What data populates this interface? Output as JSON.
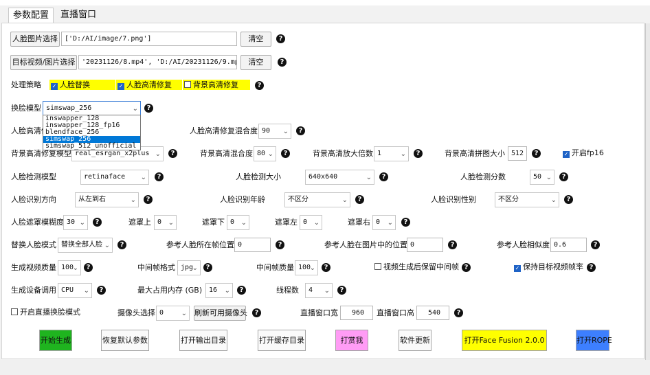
{
  "tabs": [
    "参数配置",
    "直播窗口"
  ],
  "face_image": {
    "label": "人脸图片选择",
    "value": "['D:/AI/image/7.png']",
    "clear": "清空"
  },
  "target_video": {
    "label": "目标视频/图片选择",
    "value": "'20231126/8.mp4', 'D:/AI/20231126/9.mp4']",
    "clear": "清空"
  },
  "strategy": {
    "label": "处理策略",
    "options": [
      {
        "label": "人脸替换",
        "checked": true
      },
      {
        "label": "人脸高清修复",
        "checked": true
      },
      {
        "label": "背景高清修复",
        "checked": false
      }
    ]
  },
  "swap_model": {
    "label": "换脸模型",
    "value": "simswap_256",
    "options": [
      "inswapper_128",
      "inswapper_128_fp16",
      "blendface_256",
      "simswap_256",
      "simswap_512_unofficial"
    ],
    "selected_index": 3
  },
  "face_enhance": {
    "label": "人脸高清修",
    "blend_label": "人脸高清修复混合度",
    "blend_value": "90"
  },
  "bg_enhance": {
    "model_label": "背景高清修复模型",
    "model_value": "real_esrgan_x2plus",
    "blend_label": "背景高清混合度",
    "blend_value": "80",
    "scale_label": "背景高清放大倍数",
    "scale_value": "1",
    "tile_label": "背景高清拼图大小",
    "tile_value": "512",
    "fp16_label": "开启fp16",
    "fp16_checked": true
  },
  "detection": {
    "model_label": "人脸检测模型",
    "model_value": "retinaface",
    "size_label": "人脸检测大小",
    "size_value": "640x640",
    "score_label": "人脸检测分数",
    "score_value": "50"
  },
  "recognition": {
    "direction_label": "人脸识别方向",
    "direction_value": "从左到右",
    "age_label": "人脸识别年龄",
    "age_value": "不区分",
    "gender_label": "人脸识别性别",
    "gender_value": "不区分"
  },
  "mask": {
    "blur_label": "人脸遮罩模糊度",
    "blur_value": "30",
    "top_label": "遮罩上",
    "top_value": "0",
    "bottom_label": "遮罩下",
    "bottom_value": "0",
    "left_label": "遮罩左",
    "left_value": "0",
    "right_label": "遮罩右",
    "right_value": "0"
  },
  "replace": {
    "mode_label": "替换人脸模式",
    "mode_value": "替换全部人脸",
    "frame_pos_label": "参考人脸所在帧位置",
    "frame_pos_value": "0",
    "img_pos_label": "参考人脸在图片中的位置",
    "img_pos_value": "0",
    "similarity_label": "参考人脸相似度",
    "similarity_value": "0.6"
  },
  "output": {
    "quality_label": "生成视频质量",
    "quality_value": "100",
    "frame_format_label": "中间帧格式",
    "frame_format_value": "jpg",
    "frame_quality_label": "中间帧质量",
    "frame_quality_value": "100",
    "keep_frames_label": "视频生成后保留中间帧",
    "keep_frames_checked": false,
    "keep_fps_label": "保持目标视频帧率",
    "keep_fps_checked": true
  },
  "device": {
    "label": "生成设备调用",
    "value": "CPU",
    "memory_label": "最大占用内存 (GB)",
    "memory_value": "16",
    "threads_label": "线程数",
    "threads_value": "4"
  },
  "live": {
    "enable_label": "开启直播换脸模式",
    "enable_checked": false,
    "camera_label": "摄像头选择",
    "camera_value": "0",
    "refresh_label": "刷新可用摄像头",
    "width_label": "直播窗口宽",
    "width_value": "960",
    "height_label": "直播窗口高",
    "height_value": "540"
  },
  "actions": {
    "start": "开始生成",
    "reset": "恢复默认参数",
    "open_output": "打开输出目录",
    "open_cache": "打开缓存目录",
    "donate": "打赏我",
    "update": "软件更新",
    "open_fusion": "打开Face Fusion 2.0.0",
    "open_rope": "打开ROPE"
  },
  "help_glyph": "?",
  "checkmark_glyph": "✓",
  "colors": {
    "start": "#1fb41f",
    "donate": "#ff9cf5",
    "fusion": "#ffff00",
    "rope": "#3d7fff",
    "highlight": "#ffff00"
  }
}
